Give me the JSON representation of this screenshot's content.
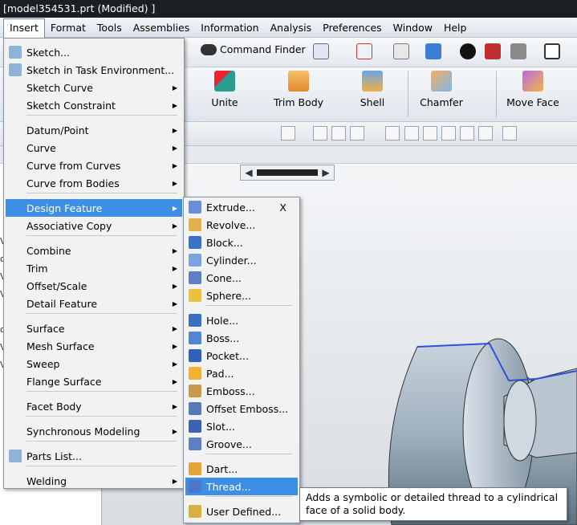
{
  "window": {
    "title": "[model354531.prt (Modified) ]"
  },
  "menubar": [
    "Insert",
    "Format",
    "Tools",
    "Assemblies",
    "Information",
    "Analysis",
    "Preferences",
    "Window",
    "Help"
  ],
  "toolbar": {
    "command_finder": "Command Finder",
    "unite": "Unite",
    "trim_body": "Trim Body",
    "shell": "Shell",
    "chamfer": "Chamfer",
    "move_face": "Move Face"
  },
  "left_edge_text": [
    "Vi",
    "or",
    "Vi",
    "Vi",
    "or",
    "Vi",
    "Vi"
  ],
  "insert_menu": {
    "items": [
      {
        "label": "Sketch...",
        "icon": "sketch-icon",
        "submenu": false
      },
      {
        "label": "Sketch in Task Environment...",
        "icon": "sketch-task-icon",
        "submenu": false
      },
      {
        "label": "Sketch Curve",
        "submenu": true
      },
      {
        "label": "Sketch Constraint",
        "submenu": true
      },
      {
        "label": "Datum/Point",
        "submenu": true
      },
      {
        "label": "Curve",
        "submenu": true
      },
      {
        "label": "Curve from Curves",
        "submenu": true
      },
      {
        "label": "Curve from Bodies",
        "submenu": true
      },
      {
        "label": "Design Feature",
        "submenu": true,
        "highlighted": true
      },
      {
        "label": "Associative Copy",
        "submenu": true
      },
      {
        "label": "Combine",
        "submenu": true
      },
      {
        "label": "Trim",
        "submenu": true
      },
      {
        "label": "Offset/Scale",
        "submenu": true
      },
      {
        "label": "Detail Feature",
        "submenu": true
      },
      {
        "label": "Surface",
        "submenu": true
      },
      {
        "label": "Mesh Surface",
        "submenu": true
      },
      {
        "label": "Sweep",
        "submenu": true
      },
      {
        "label": "Flange Surface",
        "submenu": true
      },
      {
        "label": "Facet Body",
        "submenu": true
      },
      {
        "label": "Synchronous Modeling",
        "submenu": true
      },
      {
        "label": "Parts List...",
        "icon": "parts-list-icon",
        "submenu": false
      },
      {
        "label": "Welding",
        "submenu": true
      }
    ]
  },
  "design_feature_menu": {
    "items": [
      {
        "label": "Extrude...",
        "shortcut": "X",
        "icon": "extrude-icon"
      },
      {
        "label": "Revolve...",
        "icon": "revolve-icon"
      },
      {
        "label": "Block...",
        "icon": "block-icon"
      },
      {
        "label": "Cylinder...",
        "icon": "cylinder-icon"
      },
      {
        "label": "Cone...",
        "icon": "cone-icon"
      },
      {
        "label": "Sphere...",
        "icon": "sphere-icon"
      },
      {
        "label": "Hole...",
        "icon": "hole-icon"
      },
      {
        "label": "Boss...",
        "icon": "boss-icon"
      },
      {
        "label": "Pocket...",
        "icon": "pocket-icon"
      },
      {
        "label": "Pad...",
        "icon": "pad-icon"
      },
      {
        "label": "Emboss...",
        "icon": "emboss-icon"
      },
      {
        "label": "Offset Emboss...",
        "icon": "offset-emboss-icon"
      },
      {
        "label": "Slot...",
        "icon": "slot-icon"
      },
      {
        "label": "Groove...",
        "icon": "groove-icon"
      },
      {
        "label": "Dart...",
        "icon": "dart-icon"
      },
      {
        "label": "Thread...",
        "icon": "thread-icon",
        "highlighted": true
      },
      {
        "label": "User Defined...",
        "icon": "user-defined-icon"
      }
    ]
  },
  "tooltip": {
    "text": "Adds a symbolic or detailed thread to a cylindrical face of a solid body."
  }
}
